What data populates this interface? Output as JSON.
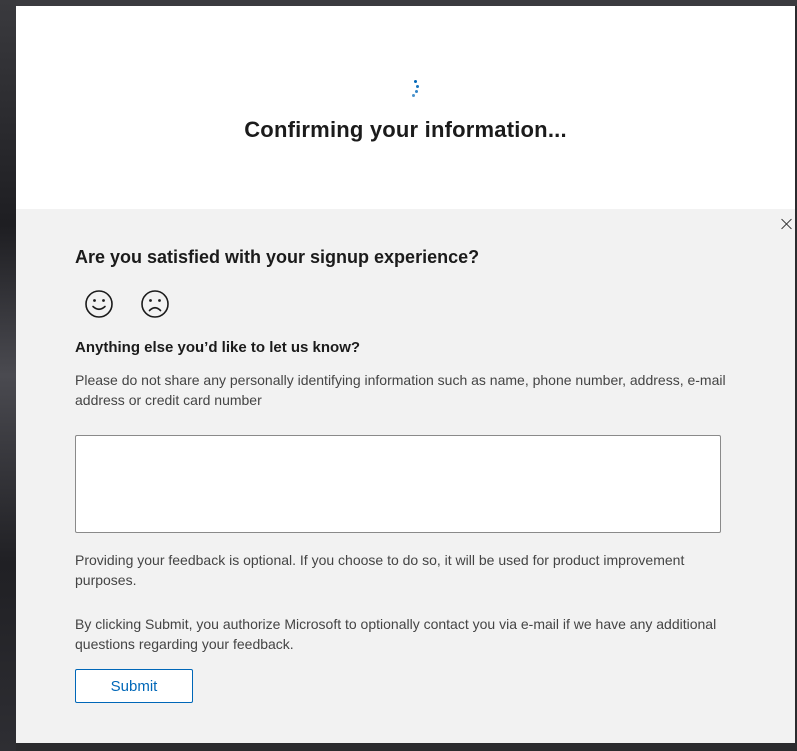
{
  "header": {
    "title": "Confirming your information..."
  },
  "feedback": {
    "question": "Are you satisfied with your signup experience?",
    "follow_up": "Anything else you’d like to let us know?",
    "privacy_note": "Please do not share any personally identifying information such as name, phone number, address, e-mail address or credit card number",
    "input_value": "",
    "optional_note": "Providing your feedback is optional. If you choose to do so, it will be used for product improvement purposes.",
    "consent_note": "By clicking Submit, you authorize Microsoft to optionally contact you via e-mail if we have any additional questions regarding your feedback.",
    "submit_label": "Submit"
  },
  "icons": {
    "spinner": "loading-spinner-icon",
    "close": "close-icon",
    "satisfied": "smiley-face-icon",
    "dissatisfied": "frown-face-icon"
  },
  "colors": {
    "accent": "#0067b8",
    "feedback_background": "#f2f2f2",
    "title_text": "#1b1b1b"
  }
}
